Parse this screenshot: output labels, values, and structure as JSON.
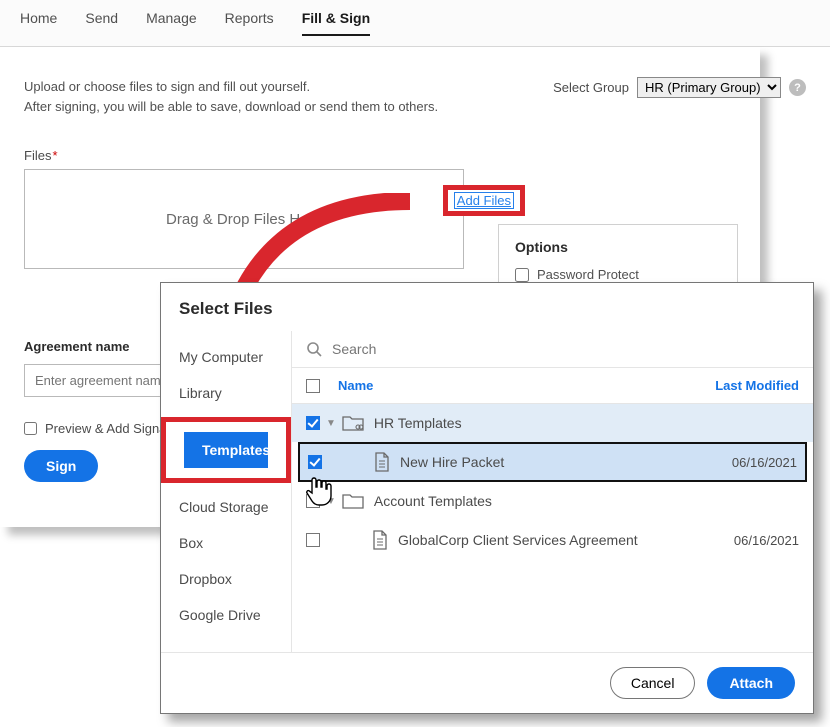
{
  "nav": {
    "items": [
      {
        "label": "Home"
      },
      {
        "label": "Send"
      },
      {
        "label": "Manage"
      },
      {
        "label": "Reports"
      },
      {
        "label": "Fill & Sign"
      }
    ],
    "active_index": 4
  },
  "intro": {
    "line1": "Upload or choose files to sign and fill out yourself.",
    "line2": "After signing, you will be able to save, download or send them to others."
  },
  "select_group": {
    "label": "Select Group",
    "value": "HR (Primary Group)"
  },
  "files": {
    "label": "Files",
    "add_files": "Add Files",
    "dropzone": "Drag & Drop Files Here"
  },
  "options": {
    "heading": "Options",
    "password_protect": "Password Protect"
  },
  "agreement": {
    "label": "Agreement name",
    "placeholder": "Enter agreement name"
  },
  "preview_label": "Preview & Add Signa",
  "sign_button": "Sign",
  "modal": {
    "title": "Select Files",
    "sidebar": {
      "my_computer": "My Computer",
      "library": "Library",
      "templates": "Templates",
      "cloud_storage": "Cloud Storage",
      "box": "Box",
      "dropbox": "Dropbox",
      "google_drive": "Google Drive"
    },
    "search_placeholder": "Search",
    "columns": {
      "name": "Name",
      "last_modified": "Last Modified"
    },
    "rows": [
      {
        "type": "folder",
        "checked": true,
        "name": "HR Templates"
      },
      {
        "type": "file",
        "checked": true,
        "name": "New Hire Packet",
        "date": "06/16/2021",
        "selected": true
      },
      {
        "type": "folder",
        "checked": false,
        "name": "Account Templates"
      },
      {
        "type": "file",
        "checked": false,
        "name": "GlobalCorp Client Services Agreement",
        "date": "06/16/2021"
      }
    ],
    "buttons": {
      "cancel": "Cancel",
      "attach": "Attach"
    }
  }
}
